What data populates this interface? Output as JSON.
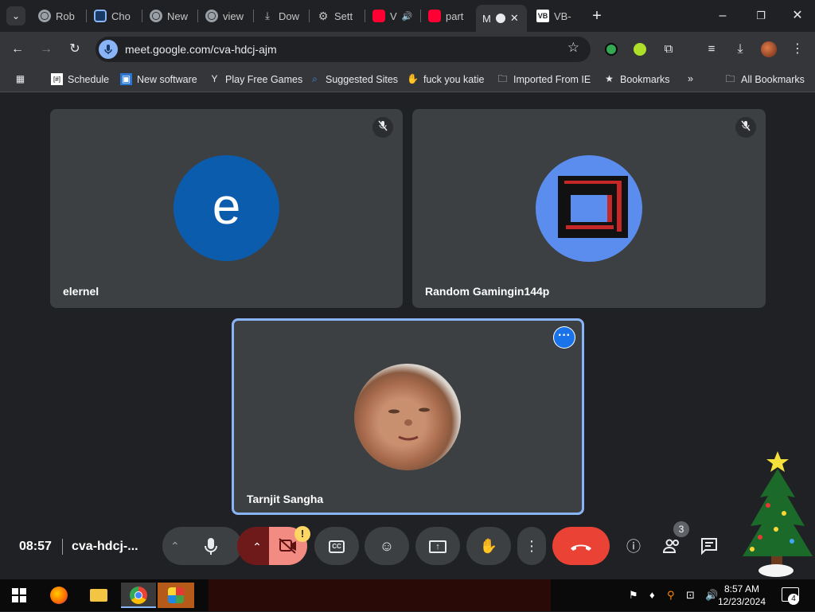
{
  "browser": {
    "tabs": [
      {
        "label": "Rob",
        "icon": "chrome-icon"
      },
      {
        "label": "Cho",
        "icon": "q-icon"
      },
      {
        "label": "New",
        "icon": "chrome-icon"
      },
      {
        "label": "view",
        "icon": "chrome-icon"
      },
      {
        "label": "Dow",
        "icon": "download-icon"
      },
      {
        "label": "Sett",
        "icon": "gear-icon"
      },
      {
        "label": "V",
        "icon": "youtube-icon"
      },
      {
        "label": "part",
        "icon": "youtube-icon"
      },
      {
        "label": "M",
        "icon": "meet-icon",
        "active": true
      },
      {
        "label": "VB-",
        "icon": "vb-icon"
      }
    ],
    "url": "meet.google.com/cva-hdcj-ajm"
  },
  "bookmarks": [
    {
      "label": "Schedule",
      "icon": "schedule-icon"
    },
    {
      "label": "New software",
      "icon": "app-icon"
    },
    {
      "label": "Play Free Games",
      "icon": "game-icon"
    },
    {
      "label": "Suggested Sites",
      "icon": "search-icon"
    },
    {
      "label": "fuck you katie",
      "icon": "hand-icon"
    },
    {
      "label": "Imported From IE",
      "icon": "folder-icon"
    },
    {
      "label": "Bookmarks",
      "icon": "star-icon"
    }
  ],
  "bookmarks_overflow": "»",
  "all_bookmarks": "All Bookmarks",
  "meeting": {
    "participants": [
      {
        "name": "elernel",
        "initial": "e",
        "avatar_color": "#0b5cad",
        "muted": true
      },
      {
        "name": "Random Gamingin144p",
        "avatar_color": "#5b8def",
        "muted": true
      },
      {
        "name": "Tarnjit Sangha",
        "photo": true,
        "muted": false
      }
    ],
    "time": "08:57",
    "code": "cva-hdcj-...",
    "people_count": "3",
    "camera_warning": "!"
  },
  "taskbar": {
    "time": "8:57 AM",
    "date": "12/23/2024",
    "notifications": "4"
  }
}
